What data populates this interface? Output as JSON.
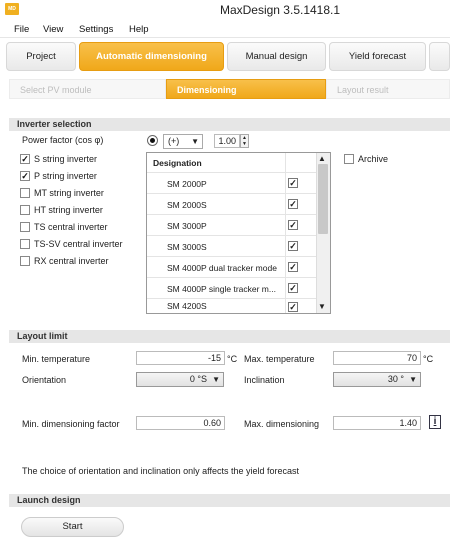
{
  "app": {
    "title": "MaxDesign 3.5.1418.1",
    "icon_label": "MD"
  },
  "menu": [
    "File",
    "View",
    "Settings",
    "Help"
  ],
  "tabs": [
    "Project",
    "Automatic dimensioning",
    "Manual design",
    "Yield forecast"
  ],
  "subtabs": [
    "Select PV module",
    "Dimensioning",
    "Layout result"
  ],
  "inverter": {
    "section": "Inverter selection",
    "power_factor_label": "Power factor (cos φ)",
    "sign": "(+)",
    "value": "1.00",
    "archive_label": "Archive",
    "types": [
      {
        "label": "S string inverter",
        "checked": true
      },
      {
        "label": "P string inverter",
        "checked": true
      },
      {
        "label": "MT string inverter",
        "checked": false
      },
      {
        "label": "HT string inverter",
        "checked": false
      },
      {
        "label": "TS central inverter",
        "checked": false
      },
      {
        "label": "TS-SV central inverter",
        "checked": false
      },
      {
        "label": "RX central inverter",
        "checked": false
      }
    ],
    "grid_header": "Designation",
    "models": [
      {
        "name": "SM 2000P",
        "checked": true
      },
      {
        "name": "SM 2000S",
        "checked": true
      },
      {
        "name": "SM 3000P",
        "checked": true
      },
      {
        "name": "SM 3000S",
        "checked": true
      },
      {
        "name": "SM 4000P dual tracker mode",
        "checked": true
      },
      {
        "name": "SM 4000P single tracker m...",
        "checked": true
      },
      {
        "name": "SM 4200S",
        "checked": true
      }
    ]
  },
  "layout": {
    "section": "Layout limit",
    "min_temp_label": "Min. temperature",
    "min_temp": "-15",
    "min_temp_unit": "°C",
    "max_temp_label": "Max. temperature",
    "max_temp": "70",
    "max_temp_unit": "°C",
    "orientation_label": "Orientation",
    "orientation": "0 °S",
    "inclination_label": "Inclination",
    "inclination": "30 °",
    "min_dim_label": "Min. dimensioning factor",
    "min_dim": "0.60",
    "max_dim_label": "Max. dimensioning",
    "max_dim": "1.40",
    "info_icon": "i",
    "note": "The choice of orientation and inclination only affects the yield forecast"
  },
  "launch": {
    "section": "Launch design",
    "start": "Start"
  }
}
